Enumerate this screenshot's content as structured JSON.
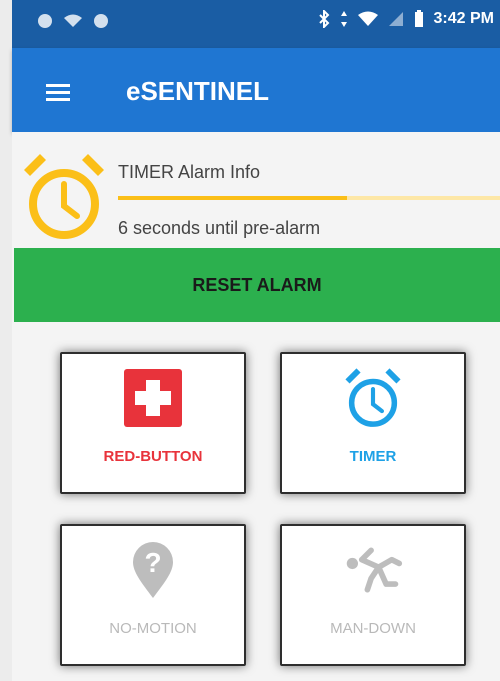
{
  "status_bar": {
    "time": "3:42 PM"
  },
  "app": {
    "title": "eSENTINEL"
  },
  "info": {
    "title": "TIMER Alarm Info",
    "subtitle": "6 seconds until pre-alarm",
    "progress": 0.6
  },
  "reset": {
    "label": "RESET ALARM"
  },
  "tiles": [
    {
      "label": "RED-BUTTON",
      "color": "#e8333b"
    },
    {
      "label": "TIMER",
      "color": "#1ea1e6"
    },
    {
      "label": "NO-MOTION",
      "color": "#b9b9b9"
    },
    {
      "label": "MAN-DOWN",
      "color": "#b9b9b9"
    }
  ],
  "colors": {
    "statusbar": "#1a5da4",
    "appbar": "#1f76d2",
    "reset": "#2cb04e",
    "alarm": "#fbbf18"
  },
  "icons": [
    "menu-icon",
    "alarm-clock-icon",
    "first-aid-icon",
    "question-marker-icon",
    "person-falling-icon",
    "bluetooth-icon",
    "wifi-icon",
    "battery-icon"
  ]
}
